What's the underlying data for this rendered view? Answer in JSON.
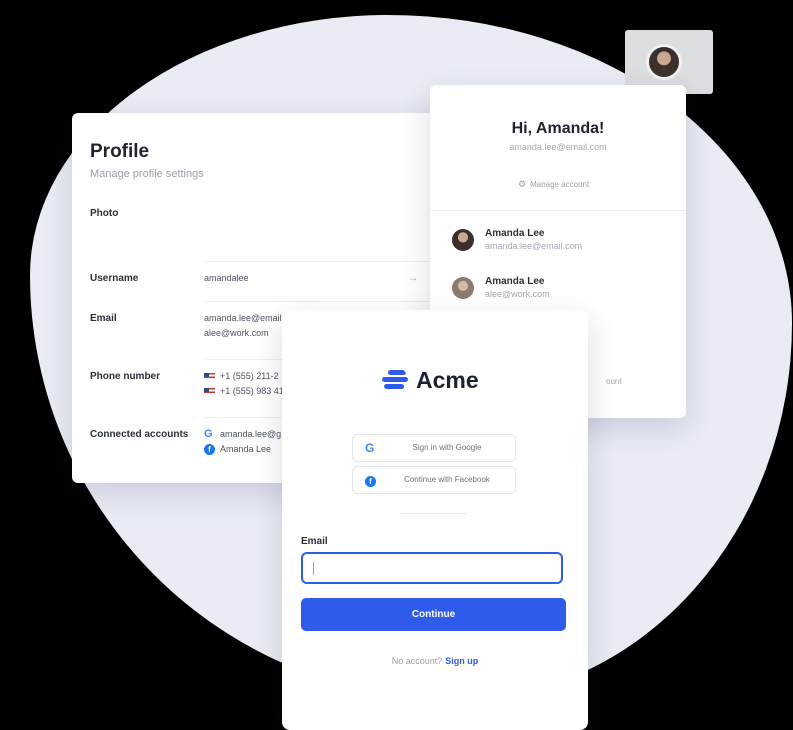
{
  "profile": {
    "title": "Profile",
    "subtitle": "Manage profile settings",
    "rows": {
      "photo": {
        "label": "Photo"
      },
      "username": {
        "label": "Username",
        "value": "amandalee"
      },
      "email": {
        "label": "Email",
        "values": [
          "amanda.lee@email",
          "alee@work.com"
        ]
      },
      "phone": {
        "label": "Phone number",
        "values": [
          "+1 (555) 211-2",
          "+1 (555) 983 41"
        ]
      },
      "connected": {
        "label": "Connected accounts",
        "values": [
          "amanda.lee@g",
          "Amanda Lee"
        ]
      }
    }
  },
  "account": {
    "greeting": "Hi, Amanda!",
    "email": "amanda.lee@email.com",
    "manage_label": "Manage account",
    "accounts": [
      {
        "name": "Amanda Lee",
        "email": "amanda.lee@email.com"
      },
      {
        "name": "Amanda Lee",
        "email": "alee@work.com"
      }
    ],
    "signout_label": "ount"
  },
  "signin": {
    "brand": "Acme",
    "google_label": "Sign in with Google",
    "facebook_label": "Continue with Facebook",
    "email_label": "Email",
    "email_value": "",
    "continue_label": "Continue",
    "no_account_text": "No account?",
    "signup_label": "Sign up"
  },
  "colors": {
    "accent": "#2f5bea",
    "backdrop": "#e9ecf4",
    "background": "#000000"
  },
  "icons": {
    "google": "G",
    "facebook": "f",
    "arrow": "→",
    "gear": "⚙"
  }
}
